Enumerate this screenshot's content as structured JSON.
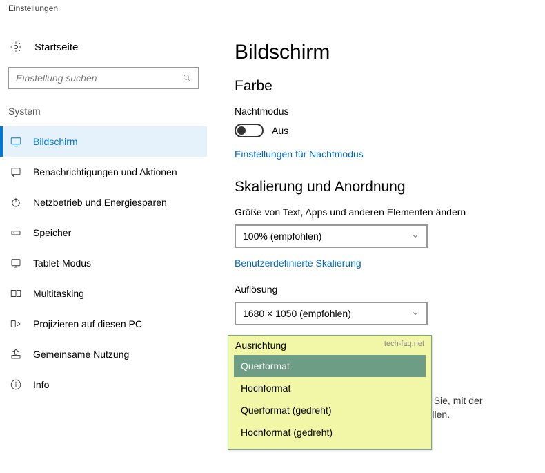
{
  "window_title": "Einstellungen",
  "home_label": "Startseite",
  "search_placeholder": "Einstellung suchen",
  "section_label": "System",
  "nav": [
    {
      "label": "Bildschirm",
      "icon": "display",
      "active": true
    },
    {
      "label": "Benachrichtigungen und Aktionen",
      "icon": "notify",
      "active": false
    },
    {
      "label": "Netzbetrieb und Energiesparen",
      "icon": "power",
      "active": false
    },
    {
      "label": "Speicher",
      "icon": "storage",
      "active": false
    },
    {
      "label": "Tablet-Modus",
      "icon": "tablet",
      "active": false
    },
    {
      "label": "Multitasking",
      "icon": "multitask",
      "active": false
    },
    {
      "label": "Projizieren auf diesen PC",
      "icon": "project",
      "active": false
    },
    {
      "label": "Gemeinsame Nutzung",
      "icon": "share",
      "active": false
    },
    {
      "label": "Info",
      "icon": "info",
      "active": false
    }
  ],
  "page": {
    "title": "Bildschirm",
    "color_h": "Farbe",
    "night_label": "Nachtmodus",
    "night_state": "Aus",
    "night_link": "Einstellungen für Nachtmodus",
    "scaling_h": "Skalierung und Anordnung",
    "scaling_label": "Größe von Text, Apps und anderen Elementen ändern",
    "scaling_value": "100% (empfohlen)",
    "scaling_link": "Benutzerdefinierte Skalierung",
    "resolution_label": "Auflösung",
    "resolution_value": "1680 × 1050 (empfohlen)",
    "orientation_label": "Ausrichtung",
    "orientation_brand": "tech-faq.net",
    "orientation_options": [
      "Querformat",
      "Hochformat",
      "Querformat (gedreht)",
      "Hochformat (gedreht)"
    ],
    "orientation_selected": 0,
    "hint": "cht immer automatisch verbunden. Versuchen Sie, mit der Erkennungsfunktion eine Verbindung herzustellen."
  }
}
